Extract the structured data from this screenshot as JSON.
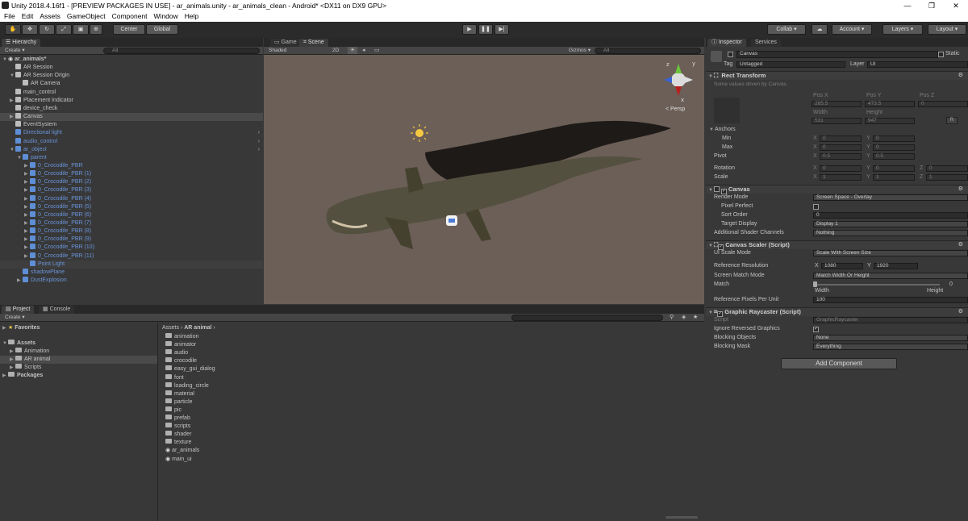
{
  "window": {
    "title": "Unity 2018.4.16f1 - [PREVIEW PACKAGES IN USE] - ar_animals.unity - ar_animals_clean - Android* <DX11 on DX9 GPU>",
    "minimize": "—",
    "maximize": "❐",
    "close": "✕"
  },
  "menu": [
    "File",
    "Edit",
    "Assets",
    "GameObject",
    "Component",
    "Window",
    "Help"
  ],
  "toolbar": {
    "center": "Center",
    "global": "Global",
    "collab": "Collab ▾",
    "account": "Account ▾",
    "layers": "Layers ▾",
    "layout": "Layout ▾"
  },
  "hierarchy": {
    "tab": "Hierarchy",
    "create": "Create ▾",
    "search_placeholder": "All",
    "rows": [
      {
        "label": "ar_animals*",
        "indent": 0,
        "arrow": "▼",
        "icon": "scene",
        "bold": true
      },
      {
        "label": "AR Session",
        "indent": 1,
        "arrow": "",
        "icon": "w"
      },
      {
        "label": "AR Session Origin",
        "indent": 1,
        "arrow": "▼",
        "icon": "w"
      },
      {
        "label": "AR Camera",
        "indent": 2,
        "arrow": "",
        "icon": "w"
      },
      {
        "label": "main_control",
        "indent": 1,
        "arrow": "",
        "icon": "w"
      },
      {
        "label": "Placement Indicator",
        "indent": 1,
        "arrow": "▶",
        "icon": "w"
      },
      {
        "label": "device_check",
        "indent": 1,
        "arrow": "",
        "icon": "w"
      },
      {
        "label": "Canvas",
        "indent": 1,
        "arrow": "▶",
        "icon": "w",
        "selected": true
      },
      {
        "label": "EventSystem",
        "indent": 1,
        "arrow": "",
        "icon": "w"
      },
      {
        "label": "Directional light",
        "indent": 1,
        "arrow": "",
        "icon": "b",
        "blue": true,
        "more": true
      },
      {
        "label": "audio_control",
        "indent": 1,
        "arrow": "",
        "icon": "b",
        "blue": true,
        "more": true
      },
      {
        "label": "ar_object",
        "indent": 1,
        "arrow": "▼",
        "icon": "b",
        "blue": true,
        "more": true
      },
      {
        "label": "parent",
        "indent": 2,
        "arrow": "▼",
        "icon": "b",
        "blue": true
      },
      {
        "label": "0_Crocodile_PBR",
        "indent": 3,
        "arrow": "▶",
        "icon": "b",
        "blue": true
      },
      {
        "label": "0_Crocodile_PBR (1)",
        "indent": 3,
        "arrow": "▶",
        "icon": "b",
        "blue": true
      },
      {
        "label": "0_Crocodile_PBR (2)",
        "indent": 3,
        "arrow": "▶",
        "icon": "b",
        "blue": true
      },
      {
        "label": "0_Crocodile_PBR (3)",
        "indent": 3,
        "arrow": "▶",
        "icon": "b",
        "blue": true
      },
      {
        "label": "0_Crocodile_PBR (4)",
        "indent": 3,
        "arrow": "▶",
        "icon": "b",
        "blue": true
      },
      {
        "label": "0_Crocodile_PBR (5)",
        "indent": 3,
        "arrow": "▶",
        "icon": "b",
        "blue": true
      },
      {
        "label": "0_Crocodile_PBR (6)",
        "indent": 3,
        "arrow": "▶",
        "icon": "b",
        "blue": true
      },
      {
        "label": "0_Crocodile_PBR (7)",
        "indent": 3,
        "arrow": "▶",
        "icon": "b",
        "blue": true
      },
      {
        "label": "0_Crocodile_PBR (8)",
        "indent": 3,
        "arrow": "▶",
        "icon": "b",
        "blue": true
      },
      {
        "label": "0_Crocodile_PBR (9)",
        "indent": 3,
        "arrow": "▶",
        "icon": "b",
        "blue": true
      },
      {
        "label": "0_Crocodile_PBR (10)",
        "indent": 3,
        "arrow": "▶",
        "icon": "b",
        "blue": true
      },
      {
        "label": "0_Crocodile_PBR (11)",
        "indent": 3,
        "arrow": "▶",
        "icon": "b",
        "blue": true
      },
      {
        "label": "Point Light",
        "indent": 3,
        "arrow": "",
        "icon": "b",
        "blue": true,
        "selected2": true
      },
      {
        "label": "shadowPlane",
        "indent": 2,
        "arrow": "",
        "icon": "b",
        "blue": true
      },
      {
        "label": "DustExplosion",
        "indent": 2,
        "arrow": "▶",
        "icon": "b",
        "blue": true
      }
    ]
  },
  "scene": {
    "tabs": [
      "Game",
      "Scene"
    ],
    "active_tab": "Scene",
    "shaded": "Shaded",
    "mode_2d": "2D",
    "gizmos": "Gizmos ▾",
    "search_placeholder": "All",
    "persp": "< Persp",
    "background": "#6b5f57"
  },
  "project": {
    "tabs": [
      "Project",
      "Console"
    ],
    "active_tab": "Project",
    "create": "Create ▾",
    "favorites": "Favorites",
    "assets": "Assets",
    "packages": "Packages",
    "tree": [
      {
        "label": "Animation",
        "selected": false
      },
      {
        "label": "AR animal",
        "selected": true
      },
      {
        "label": "Scripts",
        "selected": false
      }
    ],
    "breadcrumb": [
      "Assets",
      "AR animal"
    ],
    "items": [
      {
        "label": "animation",
        "kind": "folder"
      },
      {
        "label": "animator",
        "kind": "folder"
      },
      {
        "label": "audio",
        "kind": "folder"
      },
      {
        "label": "crocodile",
        "kind": "folder"
      },
      {
        "label": "easy_gui_dialog",
        "kind": "folder"
      },
      {
        "label": "font",
        "kind": "folder"
      },
      {
        "label": "loading_circle",
        "kind": "folder"
      },
      {
        "label": "material",
        "kind": "folder"
      },
      {
        "label": "particle",
        "kind": "folder"
      },
      {
        "label": "pic",
        "kind": "folder"
      },
      {
        "label": "prefab",
        "kind": "folder"
      },
      {
        "label": "scripts",
        "kind": "folder"
      },
      {
        "label": "shader",
        "kind": "folder"
      },
      {
        "label": "texture",
        "kind": "folder"
      },
      {
        "label": "ar_animals",
        "kind": "scene"
      },
      {
        "label": "main_ui",
        "kind": "scene"
      }
    ]
  },
  "inspector": {
    "tabs": [
      "Inspector",
      "Services"
    ],
    "active_tab": "Inspector",
    "object_name": "Canvas",
    "static_label": "Static",
    "tag_label": "Tag",
    "tag_value": "Untagged",
    "layer_label": "Layer",
    "layer_value": "UI",
    "rect": {
      "header": "Rect Transform",
      "note": "Some values driven by Canvas.",
      "pos_x_label": "Pos X",
      "pos_y_label": "Pos Y",
      "pos_z_label": "Pos Z",
      "pos_x": "265.5",
      "pos_y": "473.5",
      "pos_z": "0",
      "width_label": "Width",
      "height_label": "Height",
      "width": "531",
      "height": "947",
      "anchors": "Anchors",
      "min": "Min",
      "max": "Max",
      "pivot": "Pivot",
      "min_x": "0",
      "min_y": "0",
      "max_x": "0",
      "max_y": "0",
      "pivot_x": "0.5",
      "pivot_y": "0.5",
      "rotation": "Rotation",
      "scale": "Scale",
      "rot_x": "0",
      "rot_y": "0",
      "rot_z": "0",
      "scale_x": "1",
      "scale_y": "1",
      "scale_z": "1",
      "x": "X",
      "y": "Y",
      "z": "Z",
      "r_button": "R"
    },
    "canvas": {
      "header": "Canvas",
      "render_mode_label": "Render Mode",
      "render_mode": "Screen Space - Overlay",
      "pixel_perfect_label": "Pixel Perfect",
      "sort_order_label": "Sort Order",
      "sort_order": "0",
      "target_display_label": "Target Display",
      "target_display": "Display 1",
      "shader_channels_label": "Additional Shader Channels",
      "shader_channels": "Nothing"
    },
    "scaler": {
      "header": "Canvas Scaler (Script)",
      "ui_scale_mode_label": "UI Scale Mode",
      "ui_scale_mode": "Scale With Screen Size",
      "ref_res_label": "Reference Resolution",
      "ref_x": "1080",
      "ref_y": "1920",
      "match_mode_label": "Screen Match Mode",
      "match_mode": "Match Width Or Height",
      "match_label": "Match",
      "match_value": "0",
      "width_label": "Width",
      "height_label": "Height",
      "ppu_label": "Reference Pixels Per Unit",
      "ppu": "100"
    },
    "raycaster": {
      "header": "Graphic Raycaster (Script)",
      "script_label": "Script",
      "script": "GraphicRaycaster",
      "ignore_label": "Ignore Reversed Graphics",
      "blocking_objects_label": "Blocking Objects",
      "blocking_objects": "None",
      "blocking_mask_label": "Blocking Mask",
      "blocking_mask": "Everything"
    },
    "add_component": "Add Component"
  }
}
